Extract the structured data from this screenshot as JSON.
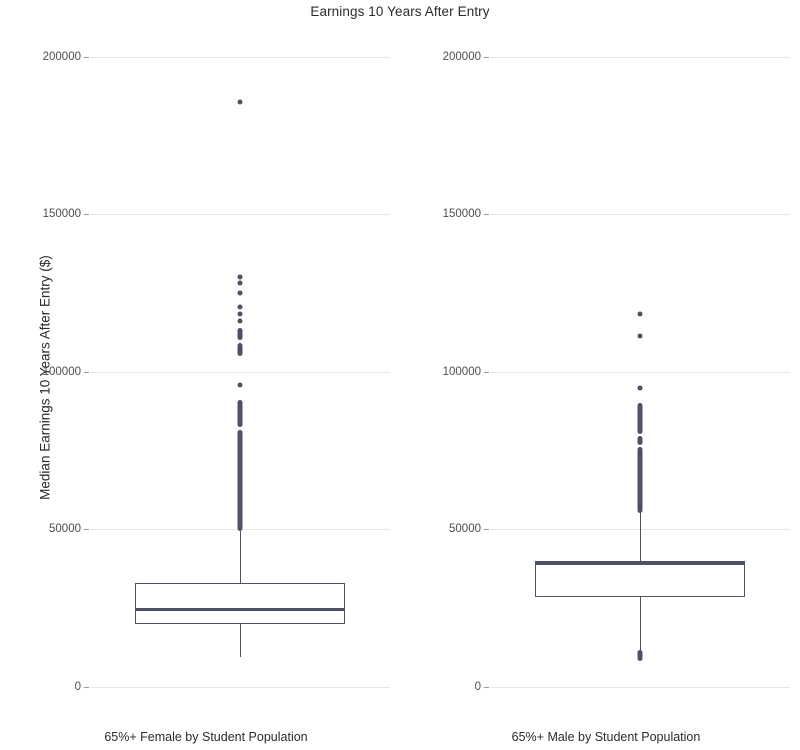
{
  "chart_data": {
    "type": "box",
    "title": "Earnings 10 Years After Entry",
    "xlabel": "",
    "ylabel": "Median Earnings 10 Years After Entry ($)",
    "ylim": [
      0,
      210000
    ],
    "y_ticks": [
      0,
      50000,
      100000,
      150000,
      200000
    ],
    "y_tick_labels": [
      "0",
      "50000",
      "100000",
      "150000",
      "200000"
    ],
    "grid": true,
    "legend": "none",
    "facet_layout": "1 row x 2 columns",
    "accent_color": "#4c5166",
    "grid_color": "#e8e8e8",
    "categories": [
      "65%+ Female by Student Population",
      "65%+ Male by Student Population"
    ],
    "boxes": [
      {
        "label": "65%+ Female by Student Population",
        "lower_whisker": 9500,
        "q1": 20000,
        "median": 24800,
        "q3": 33000,
        "upper_whisker": 49500,
        "outliers": [
          185700,
          128000,
          126000,
          123000,
          120000,
          118500,
          116500,
          113500,
          110500,
          108500,
          107000,
          97500,
          91000,
          90000,
          89000,
          88000,
          87000,
          86000,
          85000,
          84000,
          83000,
          82000,
          81000,
          80000,
          79000,
          78000,
          77000,
          76000,
          75000,
          74000,
          73000,
          72000,
          71000,
          70000,
          69000,
          68000,
          67000,
          66000,
          65000,
          64000,
          63000,
          62000,
          61000,
          60000,
          59000,
          58000,
          57000,
          56000,
          55000,
          54000,
          53000,
          52000,
          51000,
          50500
        ]
      },
      {
        "label": "65%+ Male by Student Population",
        "lower_whisker": 17000,
        "q1": 31500,
        "median": 39000,
        "q3": 40000,
        "upper_whisker": 57000,
        "outliers": [
          118500,
          111500,
          95000,
          90000,
          89000,
          88000,
          87000,
          86000,
          85000,
          84000,
          83000,
          82000,
          81000,
          80000,
          79000,
          78000,
          77000,
          76000,
          75000,
          74000,
          73000,
          72000,
          71000,
          70000,
          69000,
          68000,
          67000,
          66000,
          65000,
          64000,
          63000,
          62000,
          61000,
          60000,
          59000,
          58000,
          10500,
          9800,
          9200
        ]
      }
    ]
  },
  "title": "Earnings 10 Years After Entry",
  "axes": {
    "y_title": "Median Earnings 10 Years After Entry ($)",
    "ticks": {
      "t200000": "200000",
      "t150000": "150000",
      "t100000": "100000",
      "t50000": "50000",
      "t0": "0"
    }
  },
  "panels": {
    "female": {
      "x_label": "65%+ Female by Student Population"
    },
    "male": {
      "x_label": "65%+ Male by Student Population"
    }
  }
}
